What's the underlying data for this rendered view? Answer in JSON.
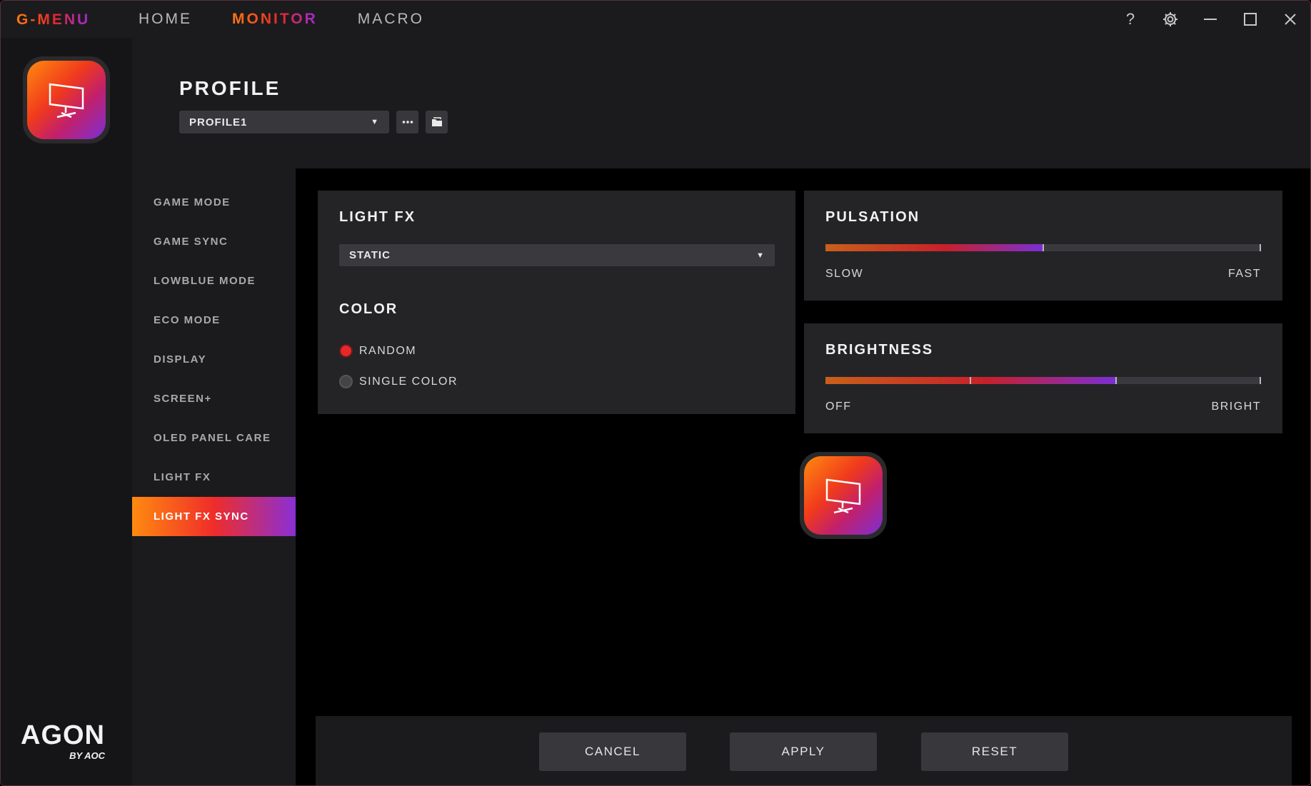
{
  "app": {
    "brand": "G-MENU"
  },
  "topnav": {
    "items": [
      "HOME",
      "MONITOR",
      "MACRO"
    ],
    "active": "MONITOR"
  },
  "window_controls": {
    "help": "?",
    "icons": [
      "help-icon",
      "gear-icon",
      "minimize-icon",
      "maximize-icon",
      "close-icon"
    ]
  },
  "profile": {
    "title": "PROFILE",
    "selected": "PROFILE1"
  },
  "sidemenu": {
    "items": [
      "GAME MODE",
      "GAME SYNC",
      "LOWBLUE MODE",
      "ECO MODE",
      "DISPLAY",
      "SCREEN+",
      "OLED PANEL CARE",
      "LIGHT FX",
      "LIGHT FX SYNC"
    ],
    "active": "LIGHT FX SYNC"
  },
  "light_fx": {
    "title": "LIGHT FX",
    "mode": "STATIC"
  },
  "color": {
    "title": "COLOR",
    "options": [
      "RANDOM",
      "SINGLE COLOR"
    ],
    "selected": "RANDOM"
  },
  "pulsation": {
    "title": "PULSATION",
    "min_label": "SLOW",
    "max_label": "FAST",
    "value": 0.5
  },
  "brightness": {
    "title": "BRIGHTNESS",
    "min_label": "OFF",
    "max_label": "BRIGHT",
    "value": 0.667,
    "marker": 0.333
  },
  "footer": {
    "cancel": "CANCEL",
    "apply": "APPLY",
    "reset": "RESET"
  },
  "logo": {
    "word": "AGON",
    "sub": "BY AOC"
  },
  "colors": {
    "accent_orange": "#ff7a10",
    "accent_red": "#e8272a",
    "accent_purple": "#9b2bd6",
    "panel": "#242427",
    "bg": "#000000"
  }
}
